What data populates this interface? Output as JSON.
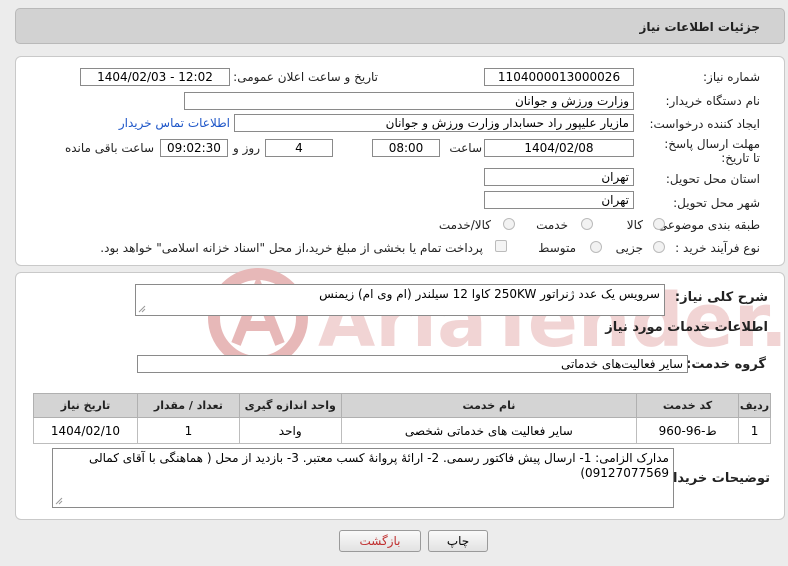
{
  "header": {
    "title": "جزئیات اطلاعات نیاز"
  },
  "fields": {
    "need_number_label": "شماره نیاز:",
    "need_number": "1104000013000026",
    "announce_label": "تاریخ و ساعت اعلان عمومی:",
    "announce_value": "1404/02/03 - 12:02",
    "buyer_org_label": "نام دستگاه خریدار:",
    "buyer_org": "وزارت ورزش و جوانان",
    "creator_label": "ایجاد کننده درخواست:",
    "creator": "مازیار  علیپور راد حسابدار وزارت ورزش و جوانان",
    "contact_link": "اطلاعات تماس خریدار",
    "deadline_label": "مهلت ارسال پاسخ: تا تاریخ:",
    "deadline_date": "1404/02/08",
    "time_label": "ساعت",
    "deadline_time": "08:00",
    "days_value": "4",
    "days_label": "روز و",
    "remaining_time": "09:02:30",
    "remaining_label": "ساعت باقی مانده",
    "province_label": "استان محل تحویل:",
    "province": "تهران",
    "city_label": "شهر محل تحویل:",
    "city": "تهران",
    "category_label": "طبقه بندی موضوعی:",
    "category_options": [
      "کالا",
      "خدمت",
      "کالا/خدمت"
    ],
    "process_label": "نوع فرآیند خرید :",
    "process_options": [
      "جزیی",
      "متوسط"
    ],
    "payment_note": "پرداخت تمام یا بخشی از مبلغ خرید،از محل \"اسناد خزانه اسلامی\" خواهد بود."
  },
  "summary": {
    "label": "شرح کلی نیاز:",
    "text": "سرویس یک عدد ژنراتور 250KW کاوا 12 سیلندر (ام وی ام) زیمنس"
  },
  "services": {
    "section_title": "اطلاعات خدمات مورد نیاز",
    "group_label": "گروه خدمت:",
    "group_value": "سایر فعالیت‌های خدماتی",
    "table": {
      "headers": [
        "ردیف",
        "کد خدمت",
        "نام خدمت",
        "واحد اندازه گیری",
        "تعداد / مقدار",
        "تاریخ نیاز"
      ],
      "rows": [
        [
          "1",
          "ط-96-960",
          "سایر فعالیت های خدماتی شخصی",
          "واحد",
          "1",
          "1404/02/10"
        ]
      ]
    }
  },
  "buyer_notes": {
    "label": "توضیحات خریدار:",
    "text": "مدارک الزامی: 1- ارسال پیش فاکتور رسمی. 2- ارائهٔ پروانهٔ کسب معتبر. 3- بازدید از محل ( هماهنگی با آقای کمالی 09127077569)"
  },
  "buttons": {
    "print": "چاپ",
    "back": "بازگشت"
  },
  "watermark": {
    "text": "AriaTender.neT"
  },
  "colors": {
    "link": "#1e56c8",
    "back_button_text": "#c03030",
    "watermark": "#e7b8b8"
  }
}
